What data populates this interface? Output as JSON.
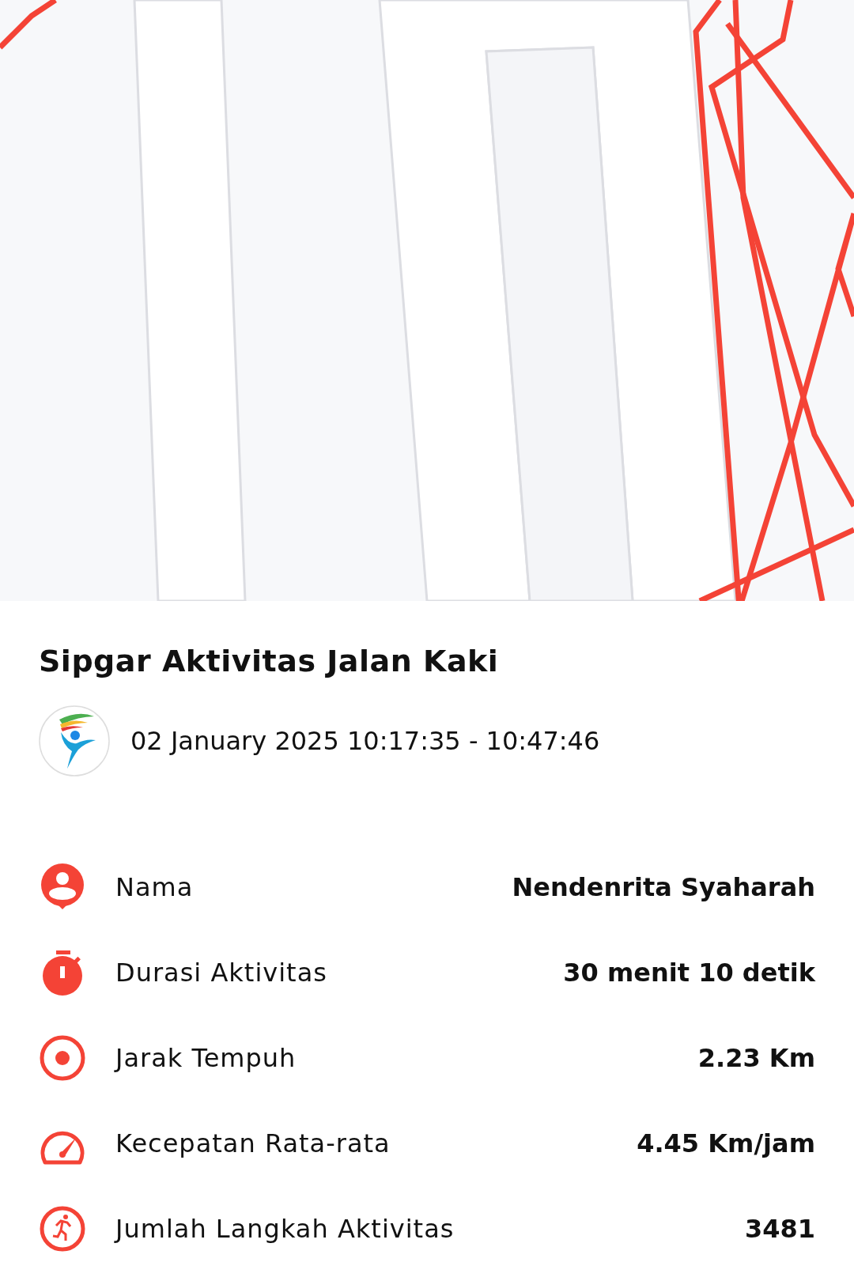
{
  "title": "Sipgar Aktivitas Jalan Kaki",
  "datetime": "02 January 2025 10:17:35 - 10:47:46",
  "stats": [
    {
      "kind": "person",
      "label": "Nama",
      "value": "Nendenrita Syaharah"
    },
    {
      "kind": "timer",
      "label": "Durasi Aktivitas",
      "value": "30 menit 10 detik"
    },
    {
      "kind": "target",
      "label": "Jarak Tempuh",
      "value": "2.23 Km"
    },
    {
      "kind": "speed",
      "label": "Kecepatan Rata-rata",
      "value": "4.45 Km/jam"
    },
    {
      "kind": "steps",
      "label": "Jumlah Langkah Aktivitas",
      "value": "3481"
    }
  ]
}
